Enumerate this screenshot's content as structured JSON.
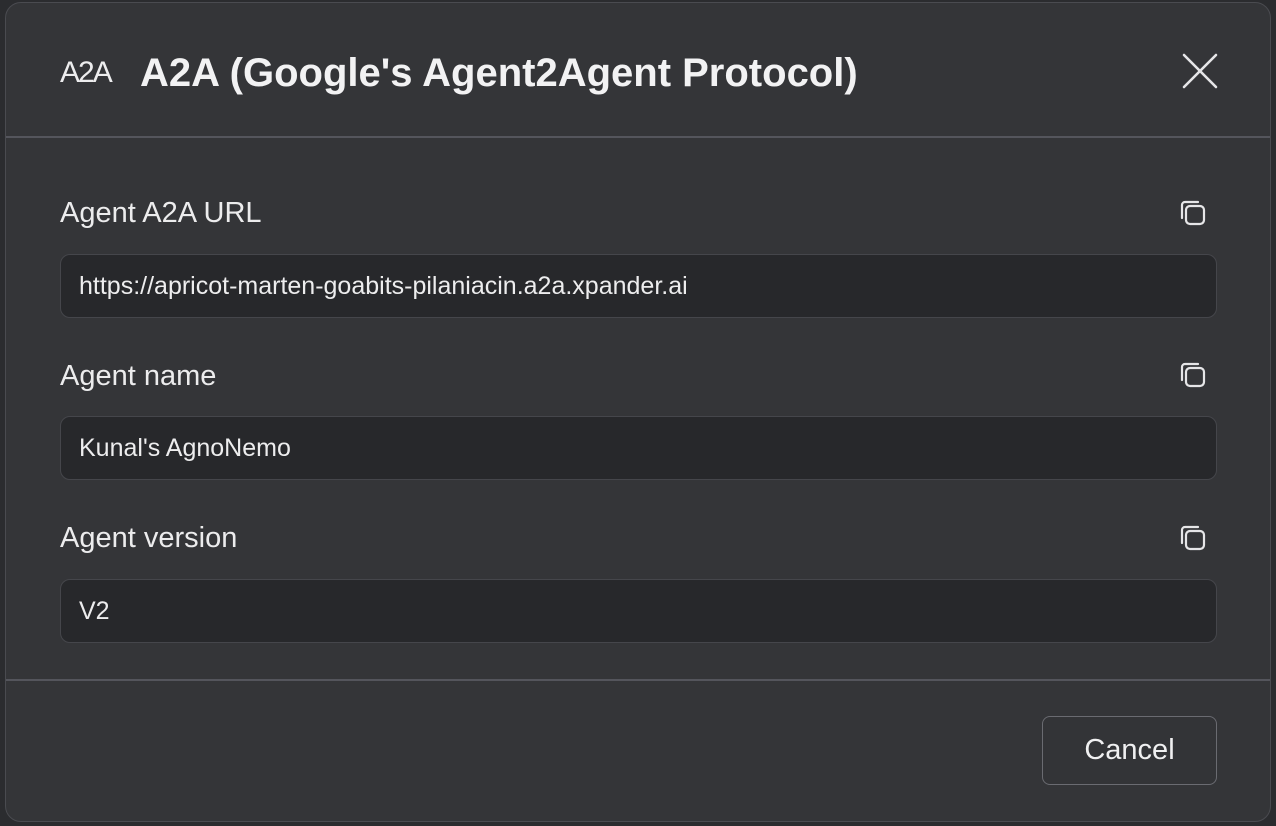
{
  "header": {
    "logo_text": "A2A",
    "title": "A2A (Google's Agent2Agent Protocol)",
    "close_icon": "close-icon"
  },
  "fields": [
    {
      "label": "Agent A2A URL",
      "value": "https://apricot-marten-goabits-pilaniacin.a2a.xpander.ai",
      "copy_icon": "copy-icon"
    },
    {
      "label": "Agent name",
      "value": "Kunal's AgnoNemo",
      "copy_icon": "copy-icon"
    },
    {
      "label": "Agent version",
      "value": "V2",
      "copy_icon": "copy-icon"
    }
  ],
  "footer": {
    "cancel_label": "Cancel"
  },
  "colors": {
    "dialog_bg": "#343538",
    "input_bg": "#27282b",
    "text": "#ededee",
    "divider": "#54555c"
  }
}
